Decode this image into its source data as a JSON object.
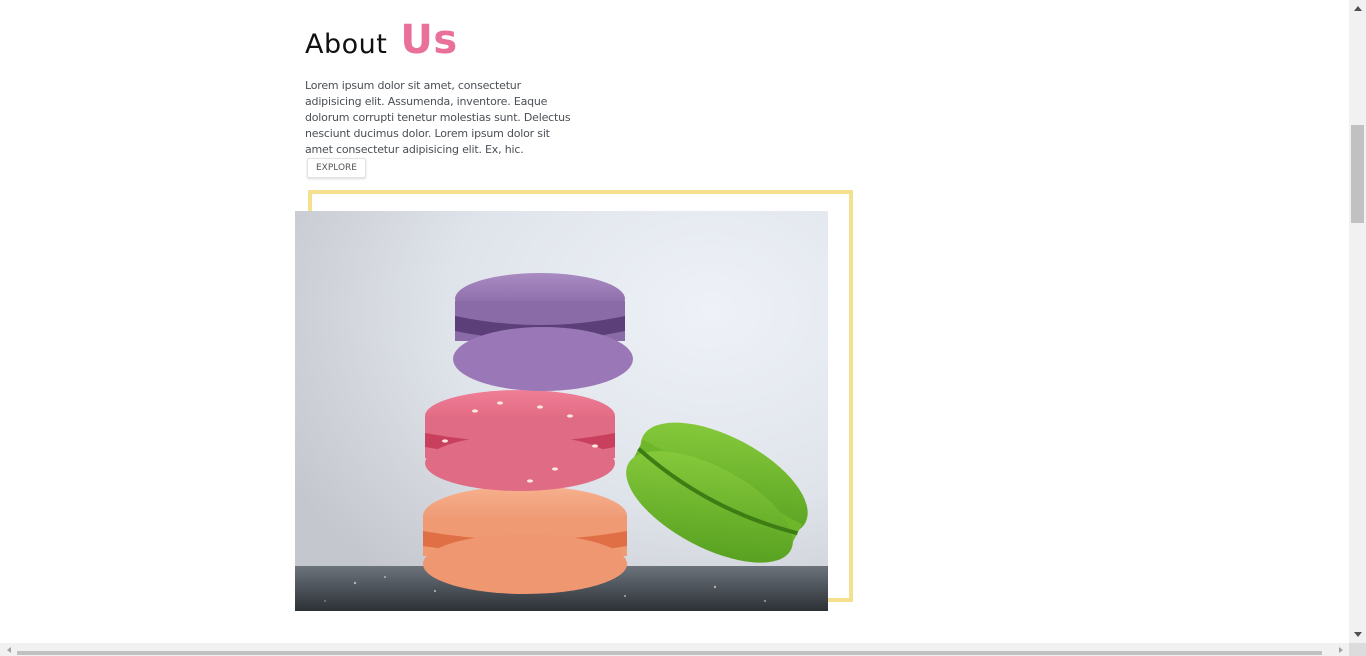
{
  "about": {
    "title_part1": "About",
    "title_part2": "Us",
    "title_accent_color": "#e8709a",
    "body": "Lorem ipsum dolor sit amet, consectetur adipisicing elit. Assumenda, inventore. Eaque dolorum corrupti tenetur molestias sunt. Delectus nesciunt ducimus dolor. Lorem ipsum dolor sit amet consectetur adipisicing elit. Ex, hic.",
    "explore_label": "EXPLORE"
  },
  "image": {
    "subject": "stack of macarons",
    "frame_color": "#f4e08f"
  },
  "scroll": {
    "vertical_position_fraction": 0.2
  }
}
